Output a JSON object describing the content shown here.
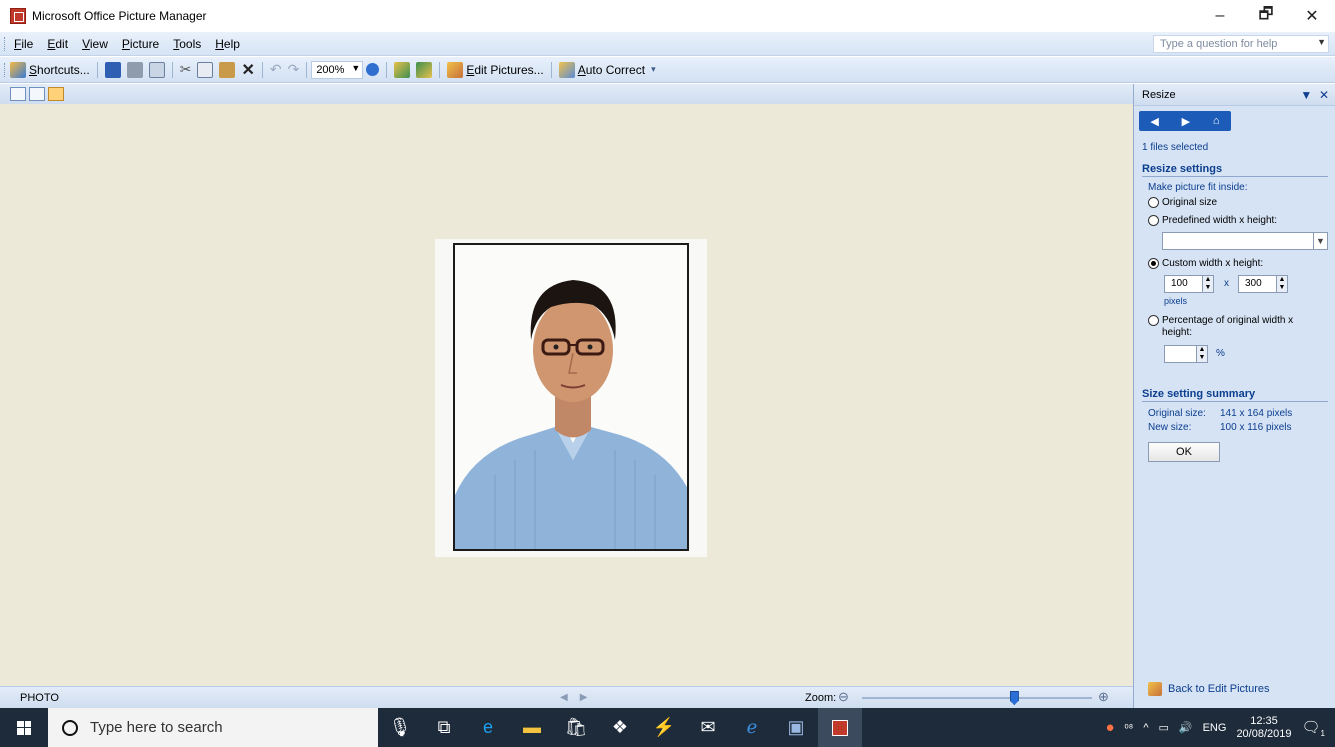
{
  "window": {
    "title": "Microsoft Office Picture Manager",
    "controls": {
      "minimize": "–",
      "maximize": "🗗",
      "close": "✕"
    }
  },
  "menu": {
    "items": [
      "File",
      "Edit",
      "View",
      "Picture",
      "Tools",
      "Help"
    ],
    "help_placeholder": "Type a question for help"
  },
  "toolbar": {
    "shortcuts_label": "Shortcuts...",
    "zoom_value": "200%",
    "edit_pictures_label": "Edit Pictures...",
    "auto_correct_label": "Auto Correct"
  },
  "statusbar": {
    "file_name": "PHOTO",
    "zoom_label": "Zoom:",
    "zoom_position": 0.66
  },
  "taskpane": {
    "title": "Resize",
    "files_selected": "1 files selected",
    "resize_settings_heading": "Resize settings",
    "fit_inside_label": "Make picture fit inside:",
    "options": {
      "original": "Original size",
      "predefined": "Predefined width x height:",
      "custom": "Custom width x height:",
      "percentage": "Percentage of original width x height:"
    },
    "selected_option": "custom",
    "custom_width": "100",
    "custom_height": "300",
    "times_sign": "x",
    "pixels_unit": "pixels",
    "percent_sign": "%",
    "summary_heading": "Size setting summary",
    "original_size_label": "Original size:",
    "original_size_value": "141 x 164 pixels",
    "new_size_label": "New size:",
    "new_size_value": "100 x 116 pixels",
    "ok_label": "OK",
    "back_link": "Back to Edit Pictures"
  },
  "taskbar": {
    "search_placeholder": "Type here to search",
    "language": "ENG",
    "time": "12:35",
    "date": "20/08/2019",
    "notification_count": "1"
  },
  "colors": {
    "canvas": "#ece9d8",
    "taskpane": "#d6e3f4",
    "heading_blue": "#0c3e8f",
    "taskbar": "#1d2b3a"
  }
}
